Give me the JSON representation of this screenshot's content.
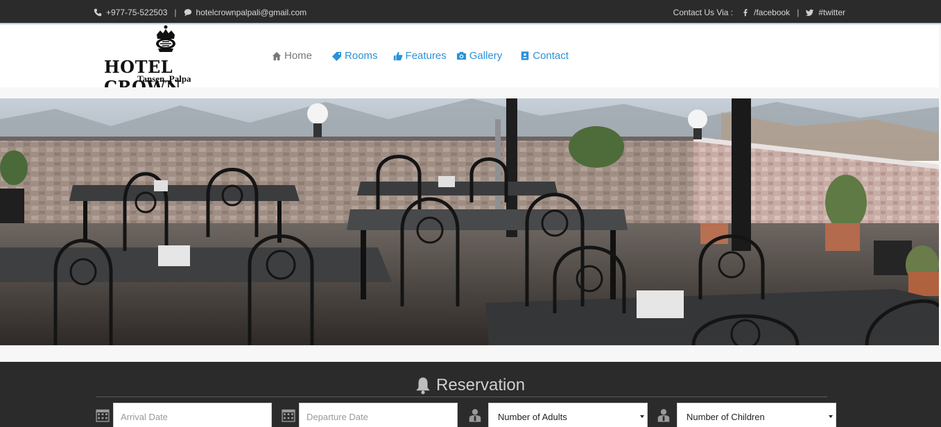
{
  "topbar": {
    "phone": "+977-75-522503",
    "email": "hotelcrownpalpali@gmail.com",
    "contact_via": "Contact Us Via :",
    "facebook": "/facebook",
    "twitter": "#twitter",
    "separator": "|"
  },
  "logo": {
    "brand": "HOTEL CROWN",
    "subtitle": "Tansen, Palpa"
  },
  "nav": {
    "home": "Home",
    "rooms": "Rooms",
    "features": "Features",
    "gallery": "Gallery",
    "contact": "Contact"
  },
  "reservation": {
    "title": "Reservation",
    "arrival_placeholder": "Arrival Date",
    "departure_placeholder": "Departure Date",
    "adults_selected": "Number of Adults",
    "children_selected": "Number of Children"
  },
  "colors": {
    "topbar_bg": "#2b2b2b",
    "accent_link": "#2a92d8",
    "topbar_border": "#9fd6e6",
    "reservation_bg": "#2b2b2b"
  },
  "icons": {
    "phone": "phone-icon",
    "chat": "chat-icon",
    "facebook": "facebook-icon",
    "twitter": "twitter-icon",
    "home": "home-icon",
    "rooms": "tag-icon",
    "features": "thumbs-up-icon",
    "gallery": "camera-icon",
    "contact": "contact-book-icon",
    "reservation": "bell-icon",
    "calendar": "calendar-icon",
    "person": "person-icon"
  }
}
